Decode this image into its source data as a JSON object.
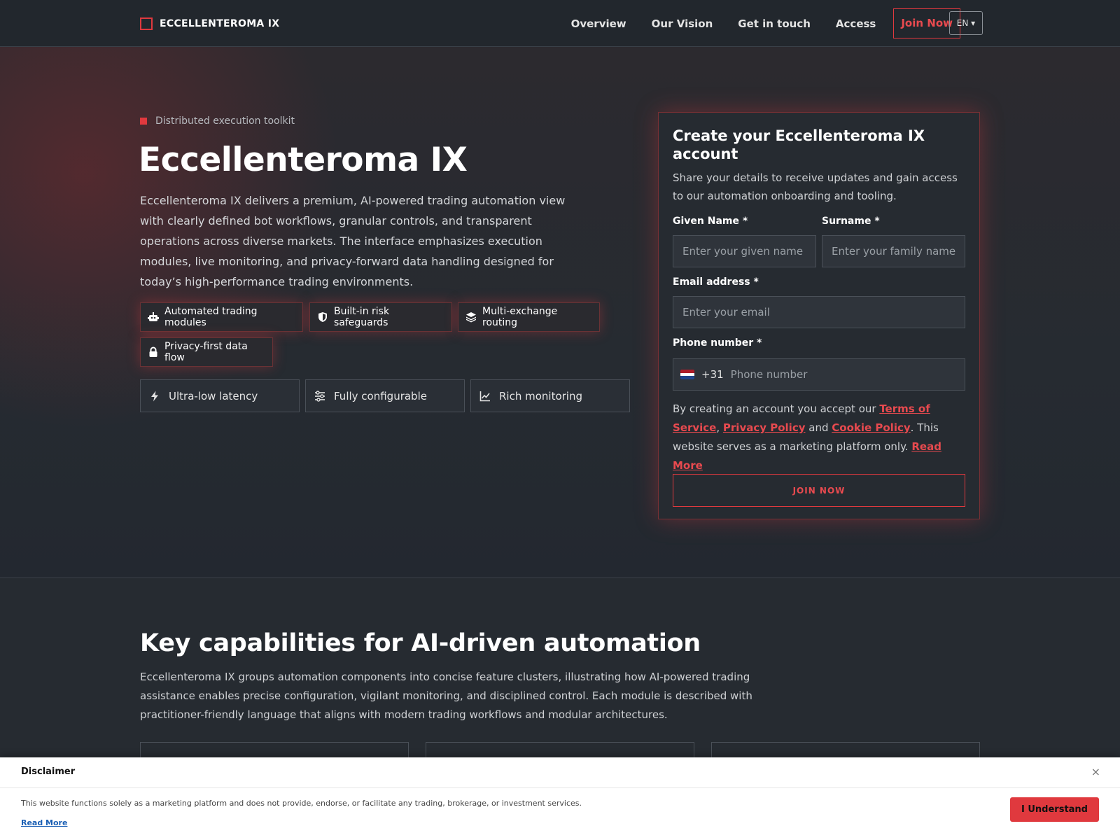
{
  "nav": {
    "brand": "ECCELLENTEROMA IX",
    "links": [
      "Overview",
      "Our Vision",
      "Get in touch",
      "Access"
    ],
    "cta": "Join Now",
    "lang": "EN ▾"
  },
  "hero": {
    "eyebrow": "Distributed execution toolkit",
    "title": "Eccellenteroma IX",
    "description": "Eccellenteroma IX delivers a premium, AI-powered trading automation view with clearly defined bot workflows, granular controls, and transparent operations across diverse markets. The interface emphasizes execution modules, live monitoring, and privacy-forward data handling designed for today’s high-performance trading environments.",
    "pills": [
      {
        "label": "Automated trading modules",
        "icon": "robot-icon"
      },
      {
        "label": "Built-in risk safeguards",
        "icon": "shield-icon"
      },
      {
        "label": "Multi-exchange routing",
        "icon": "layers-icon"
      },
      {
        "label": "Privacy-first data flow",
        "icon": "lock-icon"
      }
    ],
    "features": [
      {
        "label": "Ultra-low latency",
        "icon": "bolt-icon"
      },
      {
        "label": "Fully configurable",
        "icon": "sliders-icon"
      },
      {
        "label": "Rich monitoring",
        "icon": "chart-line-icon"
      }
    ]
  },
  "form": {
    "title": "Create your Eccellenteroma IX account",
    "subtitle": "Share your details to receive updates and gain access to our automation onboarding and tooling.",
    "given_label": "Given Name *",
    "given_placeholder": "Enter your given name",
    "surname_label": "Surname *",
    "surname_placeholder": "Enter your family name",
    "email_label": "Email address *",
    "email_placeholder": "Enter your email",
    "phone_label": "Phone number *",
    "dial_code": "+31",
    "phone_placeholder": "Phone number",
    "terms_pre": "By creating an account you accept our ",
    "terms_link": "Terms of Service",
    "terms_comma": ", ",
    "privacy_link": "Privacy Policy",
    "terms_and": " and ",
    "cookie_link": "Cookie Policy",
    "terms_post": ". This website serves as a marketing platform only. ",
    "read_more": "Read More",
    "submit": "JOIN NOW"
  },
  "section": {
    "title": "Key capabilities for AI-driven automation",
    "description": "Eccellenteroma IX groups automation components into concise feature clusters, illustrating how AI-powered trading assistance enables precise configuration, vigilant monitoring, and disciplined control. Each module is described with practitioner-friendly language that aligns with modern trading workflows and modular architectures."
  },
  "disclaimer": {
    "title": "Disclaimer",
    "close": "×",
    "text": "This website functions solely as a marketing platform and does not provide, endorse, or facilitate any trading, brokerage, or investment services.",
    "read_more": "Read More",
    "button": "I Understand"
  },
  "colors": {
    "accent": "#e0393e",
    "background": "#262b31",
    "nav_background": "#22272d"
  }
}
